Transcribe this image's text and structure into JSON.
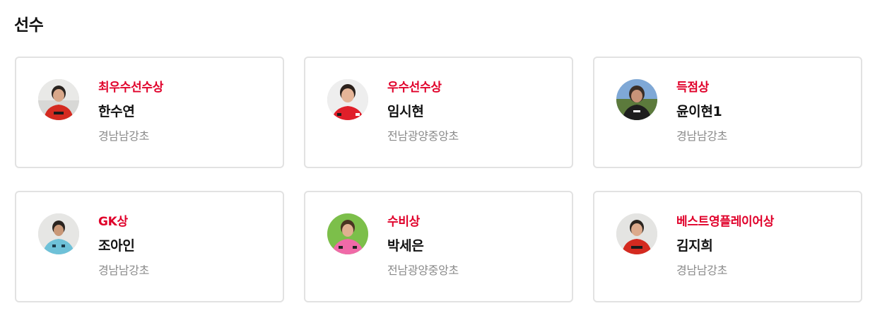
{
  "section": {
    "title": "선수"
  },
  "players": [
    {
      "award": "최우수선수상",
      "name": "한수연",
      "school": "경남남강초",
      "photo": "avatar-photo-icon"
    },
    {
      "award": "우수선수상",
      "name": "임시현",
      "school": "전남광양중앙초",
      "photo": "avatar-photo-icon"
    },
    {
      "award": "득점상",
      "name": "윤이현1",
      "school": "경남남강초",
      "photo": "avatar-photo-icon"
    },
    {
      "award": "GK상",
      "name": "조아인",
      "school": "경남남강초",
      "photo": "avatar-photo-icon"
    },
    {
      "award": "수비상",
      "name": "박세은",
      "school": "전남광양중앙초",
      "photo": "avatar-photo-icon"
    },
    {
      "award": "베스트영플레이어상",
      "name": "김지희",
      "school": "경남남강초",
      "photo": "avatar-photo-icon"
    }
  ],
  "colors": {
    "award": "#e0002a",
    "name": "#111111",
    "school": "#8a8a8a",
    "border": "#e2e2e2"
  }
}
